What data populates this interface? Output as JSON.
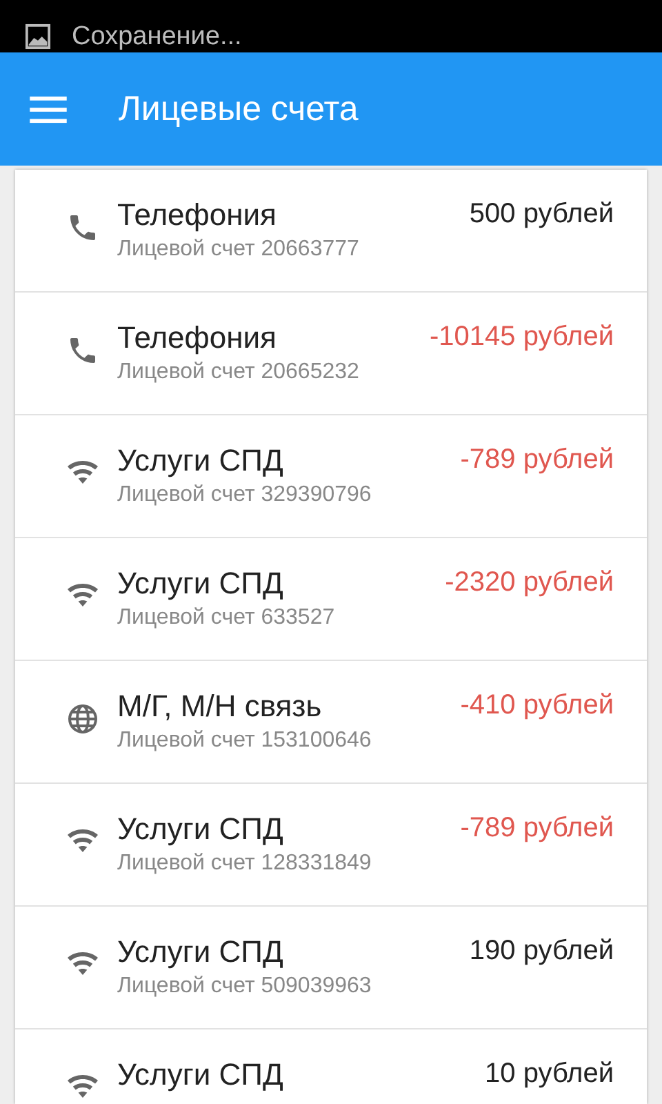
{
  "notification": {
    "text": "Сохранение..."
  },
  "app_bar": {
    "title": "Лицевые счета"
  },
  "accounts": [
    {
      "kind": "telephony",
      "title": "Телефония",
      "subtitle": "Лицевой счет 20663777",
      "amount": "500 рублей",
      "negative": false
    },
    {
      "kind": "telephony",
      "title": "Телефония",
      "subtitle": "Лицевой счет 20665232",
      "amount": "-10145 рублей",
      "negative": true
    },
    {
      "kind": "internet",
      "title": "Услуги СПД",
      "subtitle": "Лицевой счет 329390796",
      "amount": "-789 рублей",
      "negative": true
    },
    {
      "kind": "internet",
      "title": "Услуги СПД",
      "subtitle": "Лицевой счет 633527",
      "amount": "-2320 рублей",
      "negative": true
    },
    {
      "kind": "longdistance",
      "title": "М/Г, М/Н связь",
      "subtitle": "Лицевой счет 153100646",
      "amount": "-410 рублей",
      "negative": true
    },
    {
      "kind": "internet",
      "title": "Услуги СПД",
      "subtitle": "Лицевой счет 128331849",
      "amount": "-789 рублей",
      "negative": true
    },
    {
      "kind": "internet",
      "title": "Услуги СПД",
      "subtitle": "Лицевой счет 509039963",
      "amount": "190 рублей",
      "negative": false
    },
    {
      "kind": "internet",
      "title": "Услуги СПД",
      "amount": "10 рублей",
      "negative": false
    }
  ]
}
